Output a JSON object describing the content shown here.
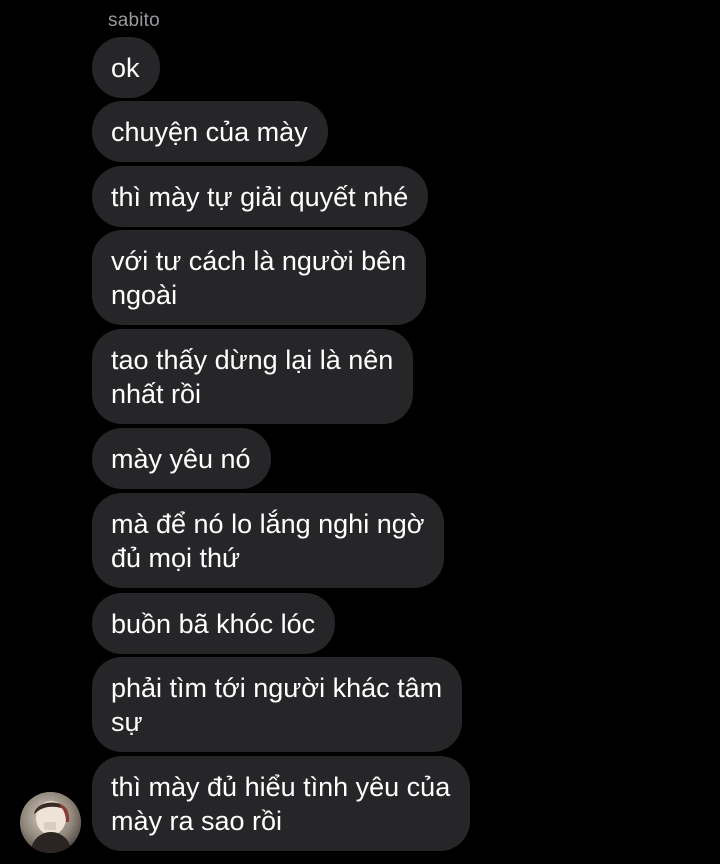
{
  "conversation": {
    "sender_name": "sabito",
    "messages": [
      {
        "text": "ok"
      },
      {
        "text": "chuyện của mày"
      },
      {
        "text": "thì mày tự giải quyết nhé"
      },
      {
        "line1": "với tư cách là người bên",
        "line2": "ngoài"
      },
      {
        "line1": "tao thấy dừng lại là nên",
        "line2": "nhất rồi"
      },
      {
        "text": "mày yêu nó"
      },
      {
        "line1": "mà để nó lo lắng nghi ngờ",
        "line2": "đủ mọi thứ"
      },
      {
        "text": "buồn bã khóc lóc"
      },
      {
        "line1": "phải tìm tới người khác tâm",
        "line2": "sự"
      },
      {
        "line1": "thì mày đủ hiểu tình yêu của",
        "line2": "mày ra sao rồi"
      }
    ]
  },
  "theme": {
    "background": "#000000",
    "bubble_color": "#262628",
    "text_color": "#ffffff",
    "name_color": "#9a9a9f"
  },
  "avatar": {
    "icon": "user-avatar-photo"
  }
}
